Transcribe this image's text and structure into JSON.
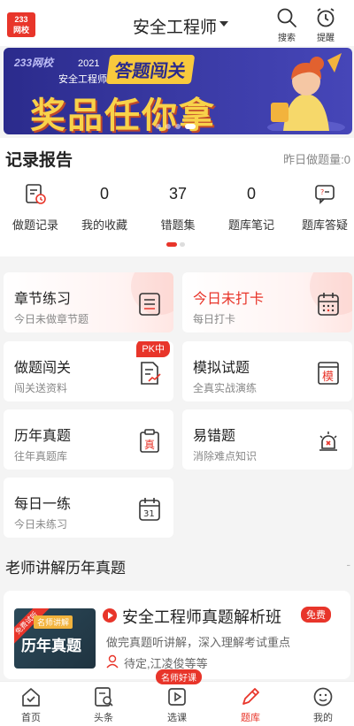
{
  "header": {
    "logo_top": "233",
    "logo_bottom": "网校",
    "title": "安全工程师",
    "search_label": "搜索",
    "remind_label": "提醒"
  },
  "banner": {
    "logo_text": "233网校",
    "year": "2021",
    "subtitle": "安全工程师",
    "tag": "答题闯关",
    "headline": "奖品任你拿"
  },
  "records": {
    "title": "记录报告",
    "yesterday": "昨日做题量:0",
    "items": [
      {
        "label": "做题记录",
        "icon": "history-icon"
      },
      {
        "label": "我的收藏",
        "value": "0"
      },
      {
        "label": "错题集",
        "value": "37"
      },
      {
        "label": "题库笔记",
        "value": "0"
      },
      {
        "label": "题库答疑",
        "icon": "qa-icon"
      }
    ]
  },
  "cards": [
    {
      "title": "章节练习",
      "sub": "今日未做章节题",
      "icon": "list-icon"
    },
    {
      "title": "今日未打卡",
      "sub": "每日打卡",
      "icon": "calendar-icon"
    },
    {
      "title": "做题闯关",
      "sub": "闯关送资料",
      "icon": "chart-doc-icon",
      "badge": "PK中"
    },
    {
      "title": "模拟试题",
      "sub": "全真实战演练",
      "icon": "mock-exam-icon",
      "icon_char": "模"
    },
    {
      "title": "历年真题",
      "sub": "往年真题库",
      "icon": "real-exam-icon",
      "icon_char": "真"
    },
    {
      "title": "易错题",
      "sub": "消除难点知识",
      "icon": "alarm-icon"
    },
    {
      "title": "每日一练",
      "sub": "今日未练习",
      "icon": "calendar-31-icon",
      "icon_char": "31"
    }
  ],
  "teacher": {
    "title": "老师讲解历年真题",
    "dash": "-",
    "course": {
      "ribbon": "免费试听",
      "thumb_tag": "名师讲解",
      "thumb_main": "历年真题",
      "name": "安全工程师真题解析班",
      "free": "免费",
      "desc": "做完真题听讲解，深入理解考试重点",
      "teachers": "待定,江凌俊等等"
    }
  },
  "tabs": [
    {
      "label": "首页",
      "icon": "home-icon"
    },
    {
      "label": "头条",
      "icon": "news-icon"
    },
    {
      "label": "选课",
      "icon": "course-icon",
      "badge": "名师好课"
    },
    {
      "label": "题库",
      "icon": "question-bank-icon",
      "active": true
    },
    {
      "label": "我的",
      "icon": "profile-icon"
    }
  ],
  "colors": {
    "accent": "#e8352a",
    "banner": "#2b2b8c",
    "gold": "#f8d24a"
  }
}
